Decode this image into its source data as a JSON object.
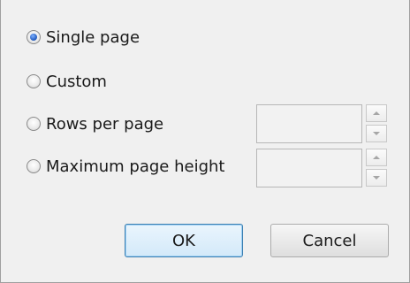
{
  "options": [
    {
      "label": "Single page",
      "checked": true
    },
    {
      "label": "Custom",
      "checked": false
    },
    {
      "label": "Rows per page",
      "checked": false
    },
    {
      "label": "Maximum page height",
      "checked": false
    }
  ],
  "spinners": {
    "rows_per_page": {
      "value": ""
    },
    "max_page_height": {
      "value": ""
    }
  },
  "buttons": {
    "ok_label": "OK",
    "cancel_label": "Cancel"
  },
  "colors": {
    "background": "#f0f0f0",
    "default_button_border": "#3c7fb1",
    "radio_selected": "#2a62c4"
  }
}
